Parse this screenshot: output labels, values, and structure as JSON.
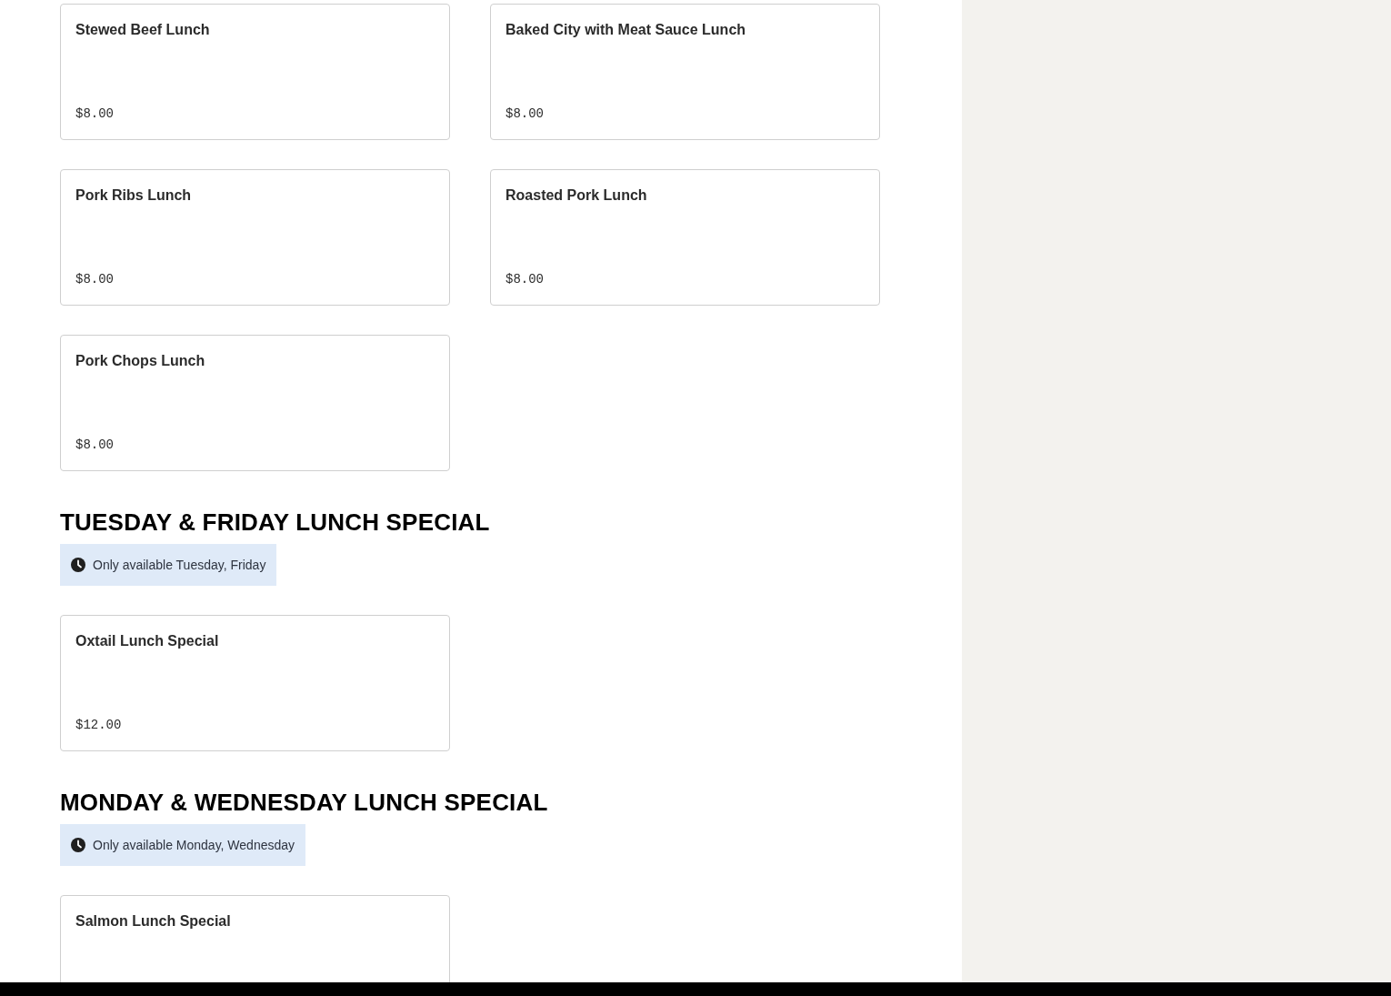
{
  "sections": [
    {
      "items": [
        {
          "name": "Stewed Beef Lunch",
          "price": "$8.00"
        },
        {
          "name": "Baked City with Meat Sauce Lunch",
          "price": "$8.00"
        },
        {
          "name": "Pork Ribs Lunch",
          "price": "$8.00"
        },
        {
          "name": "Roasted Pork Lunch",
          "price": "$8.00"
        },
        {
          "name": "Pork Chops Lunch",
          "price": "$8.00"
        }
      ]
    },
    {
      "title": "TUESDAY & FRIDAY LUNCH SPECIAL",
      "availability": "Only available Tuesday, Friday",
      "items": [
        {
          "name": "Oxtail Lunch Special",
          "price": "$12.00"
        }
      ]
    },
    {
      "title": "MONDAY & WEDNESDAY LUNCH SPECIAL",
      "availability": "Only available Monday, Wednesday",
      "items": [
        {
          "name": "Salmon Lunch Special"
        }
      ]
    }
  ]
}
